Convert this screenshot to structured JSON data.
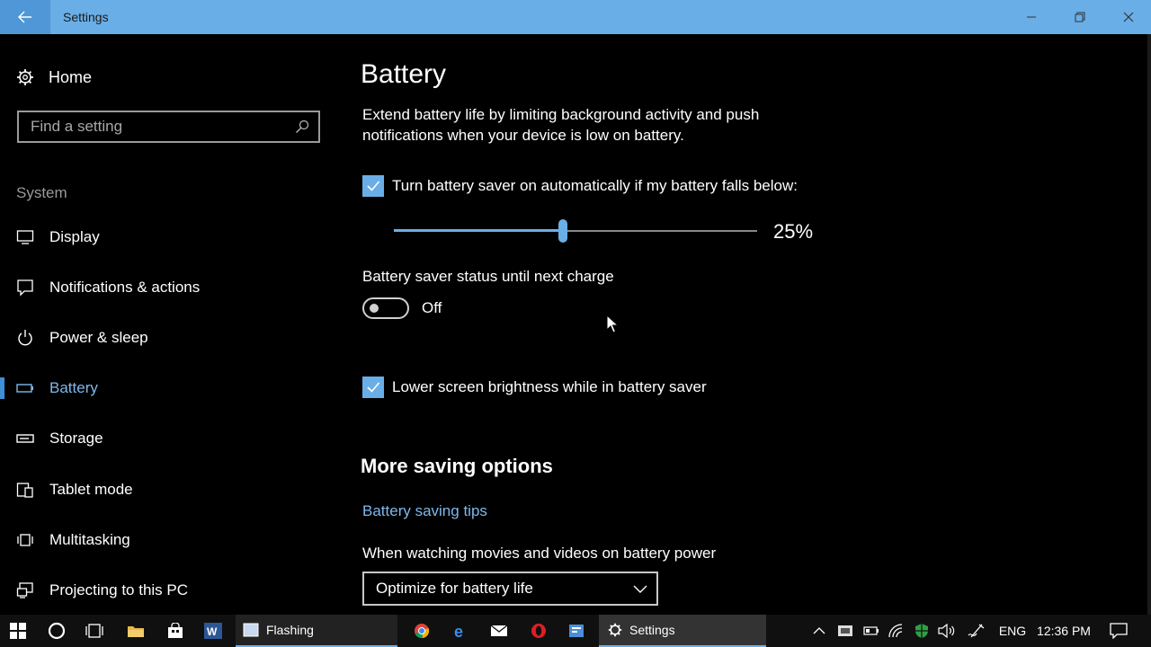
{
  "window": {
    "title": "Settings"
  },
  "sidebar": {
    "home_label": "Home",
    "search_placeholder": "Find a setting",
    "section_label": "System",
    "items": [
      {
        "label": "Display",
        "icon": "display-icon"
      },
      {
        "label": "Notifications & actions",
        "icon": "notifications-icon"
      },
      {
        "label": "Power & sleep",
        "icon": "power-icon"
      },
      {
        "label": "Battery",
        "icon": "battery-icon",
        "active": true
      },
      {
        "label": "Storage",
        "icon": "storage-icon"
      },
      {
        "label": "Tablet mode",
        "icon": "tablet-mode-icon"
      },
      {
        "label": "Multitasking",
        "icon": "multitasking-icon"
      },
      {
        "label": "Projecting to this PC",
        "icon": "projecting-icon"
      }
    ]
  },
  "main": {
    "title": "Battery",
    "description": "Extend battery life by limiting background activity and push notifications when your device is low on battery.",
    "auto_saver_label": "Turn battery saver on automatically if my battery falls below:",
    "auto_saver_checked": true,
    "threshold_percent": 25,
    "threshold_text": "25%",
    "status_label": "Battery saver status until next charge",
    "status_toggle": "Off",
    "brightness_label": "Lower screen brightness while in battery saver",
    "brightness_checked": true,
    "more_heading": "More saving options",
    "tips_link": "Battery saving tips",
    "movies_label": "When watching movies and videos on battery power",
    "movies_value": "Optimize for battery life"
  },
  "taskbar": {
    "apps": [
      {
        "label": "Flashing"
      },
      {
        "label": "Settings"
      }
    ],
    "language": "ENG",
    "time": "12:36 PM"
  },
  "colors": {
    "accent": "#6aaee7",
    "titlebar": "#6aaee7",
    "link": "#7fb8ec"
  }
}
